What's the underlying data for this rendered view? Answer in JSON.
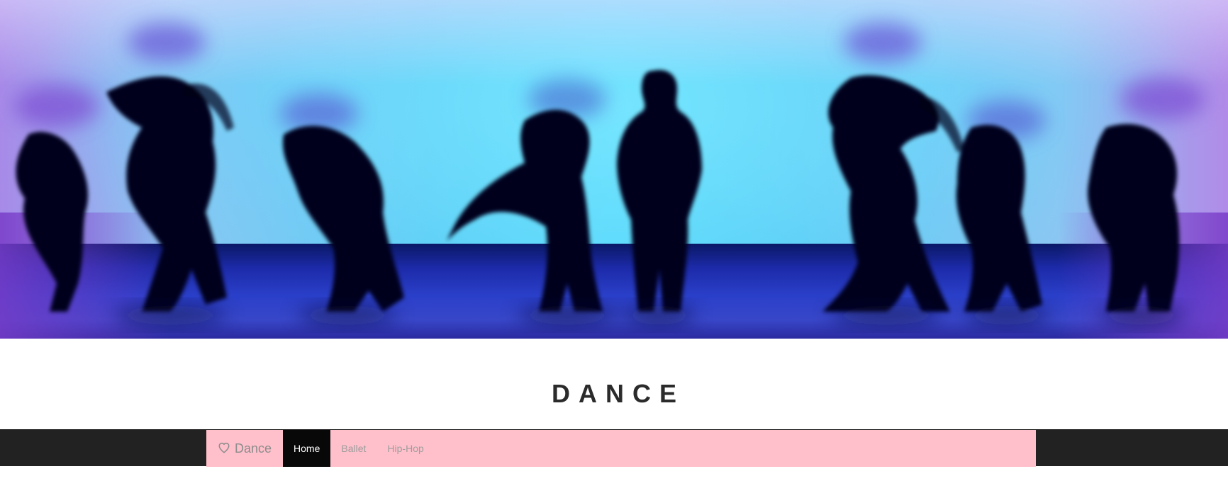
{
  "site": {
    "title": "DANCE"
  },
  "hero": {
    "icon": "dancers-silhouette-image"
  },
  "navbar": {
    "brand": {
      "icon": "heart-icon",
      "label": "Dance"
    },
    "items": [
      {
        "label": "Home",
        "active": true
      },
      {
        "label": "Ballet",
        "active": false
      },
      {
        "label": "Hip-Hop",
        "active": false
      }
    ]
  },
  "colors": {
    "navbar_bg": "#222222",
    "navbar_inner_bg": "#ffc0cb",
    "active_item_bg": "#080808",
    "title_color": "#2b2b2b"
  }
}
